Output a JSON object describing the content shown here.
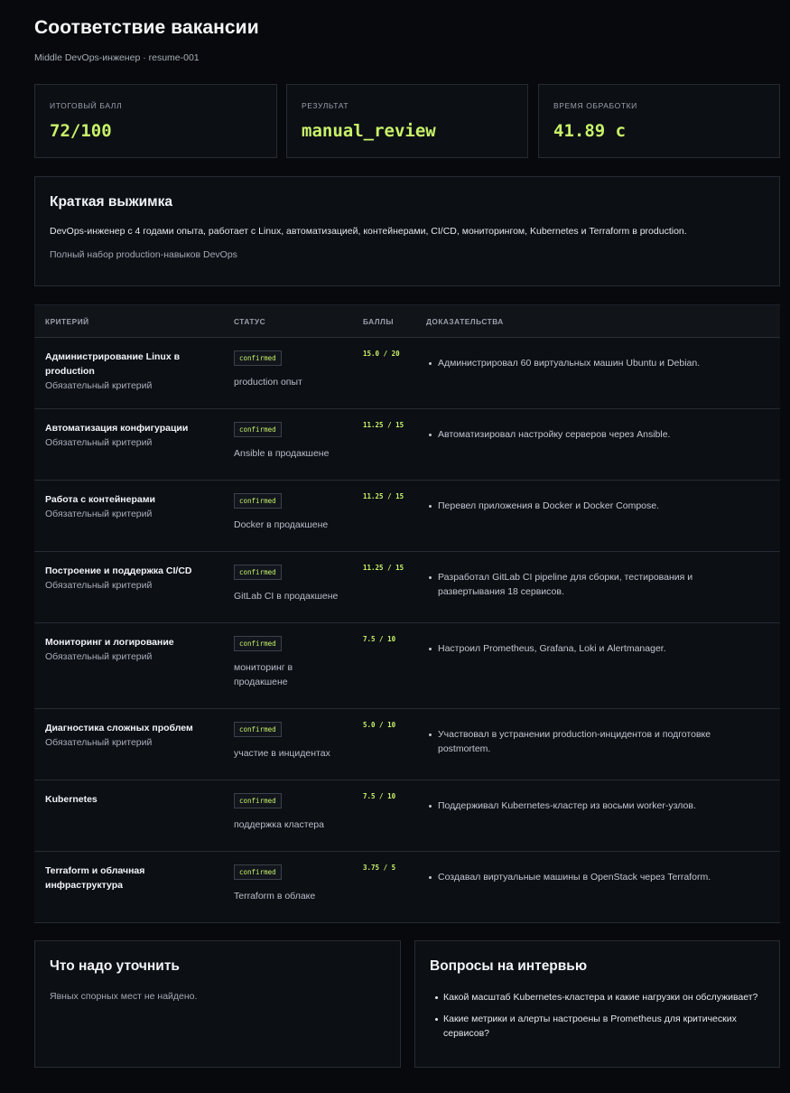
{
  "header": {
    "title": "Соответствие вакансии",
    "subtitle": "Middle DevOps-инженер · resume-001"
  },
  "stats": [
    {
      "label": "ИТОГОВЫЙ БАЛЛ",
      "value": "72/100"
    },
    {
      "label": "РЕЗУЛЬТАТ",
      "value": "manual_review"
    },
    {
      "label": "ВРЕМЯ ОБРАБОТКИ",
      "value": "41.89 с"
    }
  ],
  "summary": {
    "title": "Краткая выжимка",
    "text": "DevOps-инженер с 4 годами опыта, работает с Linux, автоматизацией, контейнерами, CI/CD, мониторингом, Kubernetes и Terraform в production.",
    "note": "Полный набор production-навыков DevOps"
  },
  "table": {
    "headers": {
      "criterion": "КРИТЕРИЙ",
      "status": "СТАТУС",
      "score": "БАЛЛЫ",
      "evidence": "ДОКАЗАТЕЛЬСТВА"
    },
    "rows": [
      {
        "name": "Администрирование Linux в production",
        "required": "Обязательный критерий",
        "badge": "confirmed",
        "status": "production опыт",
        "score": "15.0 / 20",
        "evidence": "Администрировал 60 виртуальных машин Ubuntu и Debian."
      },
      {
        "name": "Автоматизация конфигурации",
        "required": "Обязательный критерий",
        "badge": "confirmed",
        "status": "Ansible в продакшене",
        "score": "11.25 / 15",
        "evidence": "Автоматизировал настройку серверов через Ansible."
      },
      {
        "name": "Работа с контейнерами",
        "required": "Обязательный критерий",
        "badge": "confirmed",
        "status": "Docker в продакшене",
        "score": "11.25 / 15",
        "evidence": "Перевел приложения в Docker и Docker Compose."
      },
      {
        "name": "Построение и поддержка CI/CD",
        "required": "Обязательный критерий",
        "badge": "confirmed",
        "status": "GitLab CI в продакшене",
        "score": "11.25 / 15",
        "evidence": "Разработал GitLab CI pipeline для сборки, тестирования и развертывания 18 сервисов."
      },
      {
        "name": "Мониторинг и логирование",
        "required": "Обязательный критерий",
        "badge": "confirmed",
        "status": "мониторинг в продакшене",
        "score": "7.5 / 10",
        "evidence": "Настроил Prometheus, Grafana, Loki и Alertmanager."
      },
      {
        "name": "Диагностика сложных проблем",
        "required": "Обязательный критерий",
        "badge": "confirmed",
        "status": "участие в инцидентах",
        "score": "5.0 / 10",
        "evidence": "Участвовал в устранении production-инцидентов и подготовке postmortem."
      },
      {
        "name": "Kubernetes",
        "required": "",
        "badge": "confirmed",
        "status": "поддержка кластера",
        "score": "7.5 / 10",
        "evidence": "Поддерживал Kubernetes-кластер из восьми worker-узлов."
      },
      {
        "name": "Terraform и облачная инфраструктура",
        "required": "",
        "badge": "confirmed",
        "status": "Terraform в облаке",
        "score": "3.75 / 5",
        "evidence": "Создавал виртуальные машины в OpenStack через Terraform."
      }
    ]
  },
  "clarify": {
    "title": "Что надо уточнить",
    "empty": "Явных спорных мест не найдено."
  },
  "questions": {
    "title": "Вопросы на интервью",
    "items": [
      "Какой масштаб Kubernetes-кластера и какие нагрузки он обслуживает?",
      "Какие метрики и алерты настроены в Prometheus для критических сервисов?"
    ]
  }
}
